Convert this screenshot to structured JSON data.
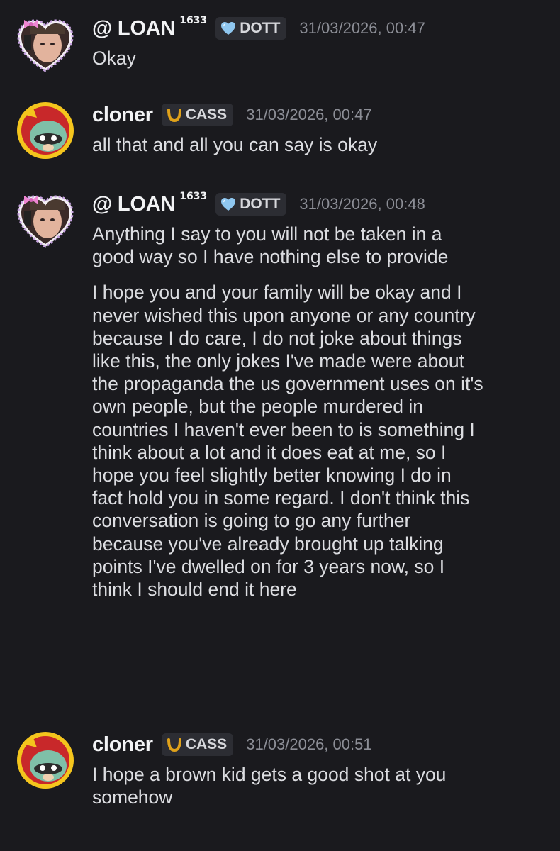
{
  "messages": [
    {
      "author": "@ LOAN",
      "badge_number": "1633",
      "tag": "DOTT",
      "tag_icon": "heart-icon",
      "timestamp": "31/03/2026, 00:47",
      "paragraphs": [
        [
          "Okay"
        ]
      ]
    },
    {
      "author": "cloner",
      "tag": "CASS",
      "tag_icon": "horseshoe-icon",
      "timestamp": "31/03/2026, 00:47",
      "paragraphs": [
        [
          "all that and all you can say is okay"
        ]
      ]
    },
    {
      "author": "@ LOAN",
      "badge_number": "1633",
      "tag": "DOTT",
      "tag_icon": "heart-icon",
      "timestamp": "31/03/2026, 00:48",
      "paragraphs": [
        [
          "Anything I say to you will not be taken in a",
          "good way so I have nothing else to provide"
        ],
        [
          "I hope you and your family will be okay and I",
          "never wished this upon anyone or any country",
          "because I do care, I do not joke about things",
          "like this, the only jokes I've made were about",
          "the propaganda the us government uses on it's",
          "own people, but the people murdered in",
          "countries I haven't ever been to is something I",
          "think about a lot and it does eat at me, so I",
          "hope you feel slightly better knowing I do in",
          "fact hold you in some regard. I don't think this",
          "conversation is going to go any further",
          "because you've already brought up talking",
          "points I've dwelled on for 3 years now, so I",
          "think I should end it here"
        ]
      ]
    },
    {
      "author": "cloner",
      "tag": "CASS",
      "tag_icon": "horseshoe-icon",
      "timestamp": "31/03/2026, 00:51",
      "paragraphs": [
        [
          "I hope a brown kid gets a good shot at you",
          "somehow"
        ]
      ]
    }
  ],
  "colors": {
    "background": "#1a1a1e",
    "tag_background": "#2c2d33",
    "timestamp": "#8c8e96",
    "heart_tag": "#8fc7f0",
    "horseshoe_tag": "#e0a21a"
  }
}
